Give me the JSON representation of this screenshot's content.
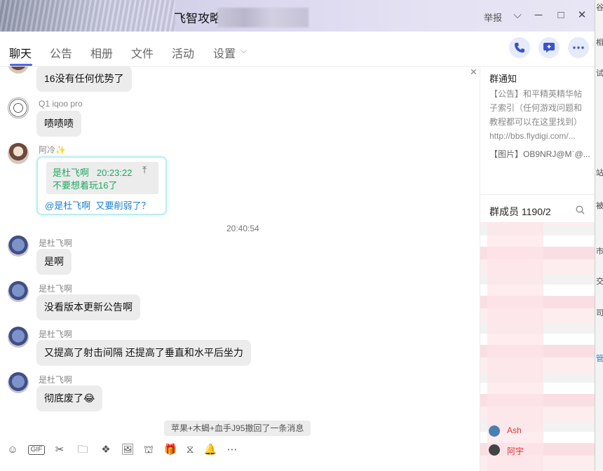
{
  "window": {
    "title": "飞智攻略",
    "report_label": "举报",
    "minimize": "─",
    "maximize": "□",
    "close": "✕",
    "dropdown": "⌵"
  },
  "tabs": [
    {
      "label": "聊天"
    },
    {
      "label": "公告"
    },
    {
      "label": "相册"
    },
    {
      "label": "文件"
    },
    {
      "label": "活动"
    },
    {
      "label": "设置"
    }
  ],
  "header_icons": [
    "phone-icon",
    "screen-share-icon",
    "more-icon"
  ],
  "messages": [
    {
      "text": "16没有任何优势了"
    },
    {
      "sender": "Q1 iqoo pro",
      "text": "啧啧啧"
    },
    {
      "sender": "阿冷✨",
      "reply": {
        "quote_name": "是杜飞啊",
        "quote_time": "20:23:22",
        "quote_text": "不要想着玩16了",
        "mention": "@是杜飞啊",
        "text": "又要削弱了？"
      }
    },
    {
      "time": "20:40:54"
    },
    {
      "sender": "是杜飞啊",
      "text": "是啊"
    },
    {
      "sender": "是杜飞啊",
      "text": "没看版本更新公告啊"
    },
    {
      "sender": "是杜飞啊",
      "text": "又提高了射击间隔 还提高了垂直和水平后坐力"
    },
    {
      "sender": "是杜飞啊",
      "text": "彻底废了😂"
    }
  ],
  "recall_notice": "苹果+木蝎+血手J95撤回了一条消息",
  "toolbar": [
    "emoji-icon",
    "gif-icon",
    "scissors-icon",
    "folder-icon",
    "sticker-icon",
    "image-icon",
    "shop-icon",
    "gift-icon",
    "history-icon",
    "bell-icon",
    "more-icon"
  ],
  "toolbar_glyphs": {
    "emoji": "☺",
    "gif": "GIF",
    "scissors": "✂",
    "folder": "🗀",
    "sticker": "❖",
    "image": "🖼",
    "shop": "⛫",
    "gift": "🎁",
    "history": "⧖",
    "bell": "🔔",
    "more": "⋯"
  },
  "group_notice": {
    "title": "群通知",
    "body": "【公告】和平精英精华帖子索引（任何游戏问题和教程都可以在这里找到）",
    "url": "http://bbs.flydigi.com/...",
    "image_line": "【图片】OB9NRJ@M`@..."
  },
  "members": {
    "title": "群成员 1190/2",
    "visible_names": [
      "Ash",
      "阿宇"
    ]
  },
  "edge_chars": [
    "谷",
    "相",
    "试",
    "站",
    "被",
    "市",
    "交",
    "司",
    "管"
  ],
  "colors": {
    "accent": "#4b67e6",
    "reply_green": "#1ba862",
    "mention_blue": "#1b7fd1",
    "member_red": "#d83a3a"
  }
}
